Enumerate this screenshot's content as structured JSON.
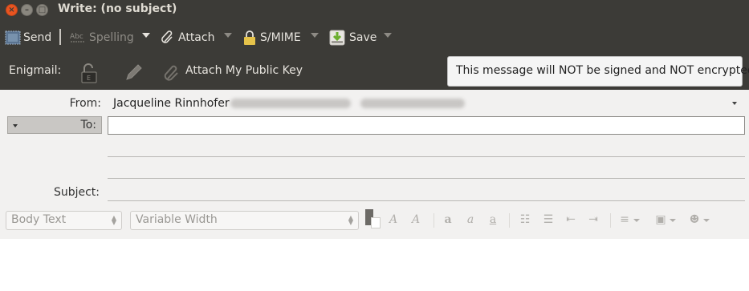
{
  "window": {
    "title": "Write: (no subject)"
  },
  "toolbar": {
    "send": "Send",
    "spelling": "Spelling",
    "attach": "Attach",
    "smime": "S/MIME",
    "save": "Save"
  },
  "enigmail": {
    "label": "Enigmail:",
    "attach_public_key": "Attach My Public Key",
    "status_tooltip": "This message will NOT be signed and NOT encrypted"
  },
  "header": {
    "from_label": "From:",
    "from_name": "Jacqueline Rinnhofer",
    "to_label": "To:",
    "to_value": "",
    "subject_label": "Subject:",
    "subject_value": ""
  },
  "format": {
    "paragraph_style": "Body Text",
    "font": "Variable Width"
  }
}
